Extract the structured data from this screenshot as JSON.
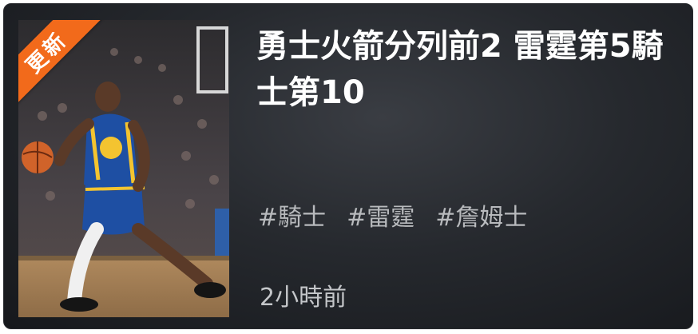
{
  "card": {
    "badge_label": "更新",
    "title": "勇士火箭分列前2 雷霆第5騎士第10",
    "tags": [
      "#騎士",
      "#雷霆",
      "#詹姆士"
    ],
    "time": "2小時前",
    "image_alt": "Basketball player in blue Golden State uniform dribbling a ball in an arena"
  },
  "colors": {
    "badge": "#f26a1b",
    "card_background": "#26292e",
    "title_text": "#ffffff",
    "tag_text": "#b8babd"
  }
}
